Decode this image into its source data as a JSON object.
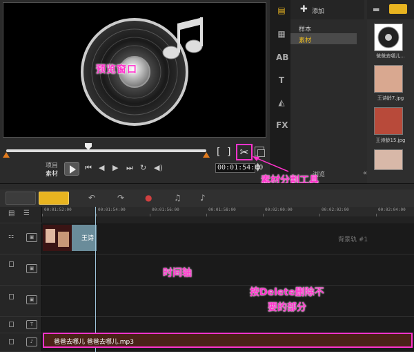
{
  "preview": {
    "label": "预览窗口",
    "brackets": {
      "start": "[",
      "end": "]"
    },
    "mode_project": "项目",
    "mode_clip": "素材",
    "timecode": "00:01:54:00"
  },
  "library": {
    "add_label": "添加",
    "folders": [
      "样本",
      "素材"
    ],
    "selected_folder": "素材",
    "browse_label": "浏览",
    "thumbnails": [
      {
        "caption": "爸爸去哪儿..."
      },
      {
        "caption": "王诗龄7.jpg"
      },
      {
        "caption": "王诗龄15.jpg"
      }
    ],
    "tab_icons": [
      "media-icon",
      "transition-icon",
      "title-icon",
      "graphic-icon",
      "filter-icon"
    ]
  },
  "timeline": {
    "ruler": [
      "00:01:52:00",
      "00:01:54:00",
      "00:01:56:00",
      "00:01:58:00",
      "00:02:00:00",
      "00:02:02:00",
      "00:02:04:00"
    ],
    "title_clip_text": "王诗",
    "background_track_label": "背景轨 #1",
    "audio_clip_name": "爸爸去哪儿 爸爸去哪儿.mp3"
  },
  "annotations": {
    "cut_tool": "素材分割工具",
    "timeline_axis": "时间轴",
    "delete_hint_1": "按Delete删除不",
    "delete_hint_2": "要的部分"
  },
  "colors": {
    "annotation": "#ff33cc",
    "timeline_button_active": "#e8b420",
    "scrub_marker": "#e07a1d",
    "title_clip": "#6a8c9a",
    "audio_clip": "#4a2218"
  }
}
